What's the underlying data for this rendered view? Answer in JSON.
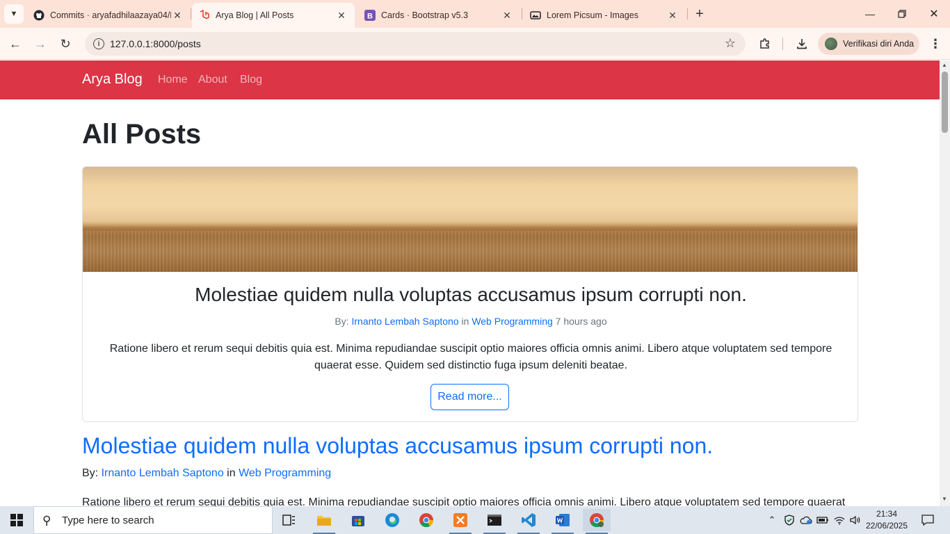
{
  "browser": {
    "tabs": [
      {
        "label": "Commits · aryafadhilaazaya04/L",
        "icon": "github-icon"
      },
      {
        "label": "Arya Blog | All Posts",
        "icon": "laravel-icon",
        "active": true
      },
      {
        "label": "Cards · Bootstrap v5.3",
        "icon": "bootstrap-icon"
      },
      {
        "label": "Lorem Picsum - Images",
        "icon": "picsum-icon"
      }
    ],
    "url": "127.0.0.1:8000/posts",
    "profile_label": "Verifikasi diri Anda"
  },
  "site": {
    "brand": "Arya Blog",
    "nav": [
      "Home",
      "About",
      "Blog"
    ],
    "accent_color": "#dc3545",
    "link_color": "#0d6efd"
  },
  "page": {
    "title": "All Posts",
    "featured": {
      "title": "Molestiae quidem nulla voluptas accusamus ipsum corrupti non.",
      "by_label": "By:",
      "author": "Irnanto Lembah Saptono",
      "in_label": "in",
      "category": "Web Programming",
      "time": "7 hours ago",
      "excerpt": "Ratione libero et rerum sequi debitis quia est. Minima repudiandae suscipit optio maiores officia omnis animi. Libero atque voluptatem sed tempore quaerat esse. Quidem sed distinctio fuga ipsum deleniti beatae.",
      "read_more": "Read more..."
    },
    "post": {
      "title": "Molestiae quidem nulla voluptas accusamus ipsum corrupti non.",
      "by_label": "By:",
      "author": "Irnanto Lembah Saptono",
      "in_label": "in",
      "category": "Web Programming",
      "excerpt": "Ratione libero et rerum sequi debitis quia est. Minima repudiandae suscipit optio maiores officia omnis animi. Libero atque voluptatem sed tempore quaerat"
    }
  },
  "taskbar": {
    "search_placeholder": "Type here to search",
    "time": "21:34",
    "date": "22/06/2025"
  }
}
